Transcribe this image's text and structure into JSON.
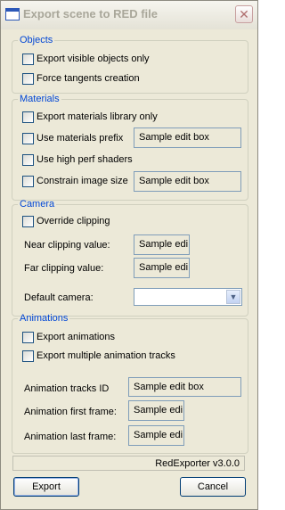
{
  "window": {
    "title": "Export scene to RED file",
    "close_glyph": "✕"
  },
  "objects": {
    "legend": "Objects",
    "export_visible": "Export visible objects only",
    "force_tangents": "Force tangents creation"
  },
  "materials": {
    "legend": "Materials",
    "export_library": "Export materials library only",
    "use_prefix": "Use materials prefix",
    "prefix_value": "Sample edit box",
    "high_perf_shaders": "Use high perf shaders",
    "constrain_size": "Constrain image size",
    "size_value": "Sample edit box"
  },
  "camera": {
    "legend": "Camera",
    "override_clipping": "Override clipping",
    "near_label": "Near clipping value:",
    "near_value": "Sample edi",
    "far_label": "Far clipping value:",
    "far_value": "Sample edi",
    "default_camera_label": "Default camera:",
    "default_camera_value": ""
  },
  "animations": {
    "legend": "Animations",
    "export_animations": "Export animations",
    "export_multiple": "Export multiple animation tracks",
    "tracks_id_label": "Animation tracks ID",
    "tracks_id_value": "Sample edit box",
    "first_frame_label": "Animation first frame:",
    "first_frame_value": "Sample edi",
    "last_frame_label": "Animation last frame:",
    "last_frame_value": "Sample edi"
  },
  "status": {
    "version": "RedExporter v3.0.0"
  },
  "buttons": {
    "export": "Export",
    "cancel": "Cancel"
  },
  "icons": {
    "window": "window-icon",
    "close": "close-icon",
    "dropdown": "chevron-down-icon"
  },
  "colors": {
    "group_legend": "#0046d5",
    "dialog_bg": "#ece9d8",
    "checkbox_border": "#1c5180"
  }
}
